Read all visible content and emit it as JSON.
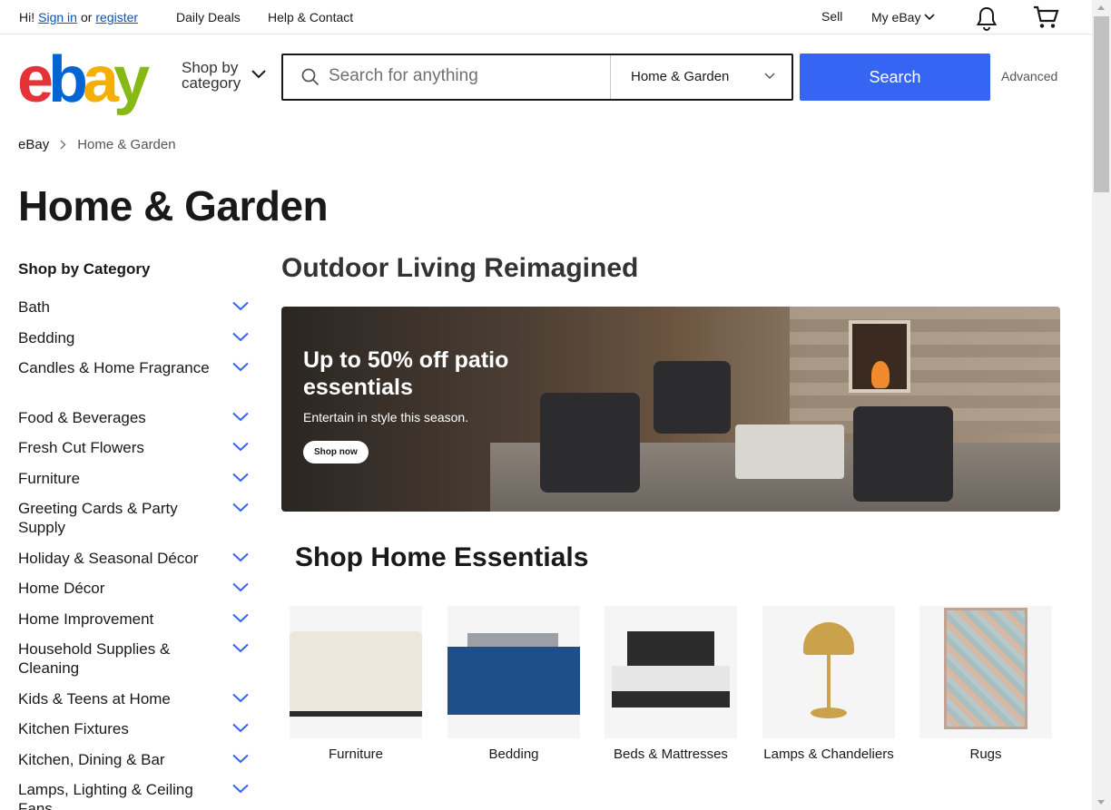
{
  "topbar": {
    "greeting": "Hi!",
    "sign_in": "Sign in",
    "or": "or",
    "register": "register",
    "daily_deals": "Daily Deals",
    "help_contact": "Help & Contact",
    "sell": "Sell",
    "my_ebay": "My eBay"
  },
  "header": {
    "logo": {
      "e": "e",
      "b": "b",
      "a": "a",
      "y": "y"
    },
    "shop_by_category": [
      "Shop by",
      "category"
    ],
    "search_placeholder": "Search for anything",
    "category_selected": "Home & Garden",
    "search_button": "Search",
    "advanced": "Advanced"
  },
  "breadcrumb": [
    "eBay",
    "Home & Garden"
  ],
  "page_title": "Home & Garden",
  "sidebar": {
    "title": "Shop by Category",
    "items": [
      "Bath",
      "Bedding",
      "Candles & Home Fragrance",
      "Food & Beverages",
      "Fresh Cut Flowers",
      "Furniture",
      "Greeting Cards & Party Supply",
      "Holiday & Seasonal Décor",
      "Home Décor",
      "Home Improvement",
      "Household Supplies & Cleaning",
      "Kids & Teens at Home",
      "Kitchen Fixtures",
      "Kitchen, Dining & Bar",
      "Lamps, Lighting & Ceiling Fans"
    ]
  },
  "promo": {
    "title": "Outdoor Living Reimagined",
    "banner_headline": "Up to 50% off patio essentials",
    "banner_sub": "Entertain in style this season.",
    "banner_button": "Shop now"
  },
  "essentials": {
    "title": "Shop Home Essentials",
    "cards": [
      "Furniture",
      "Bedding",
      "Beds & Mattresses",
      "Lamps & Chandeliers",
      "Rugs"
    ]
  },
  "colors": {
    "search_button": "#3665f3",
    "link": "#0654ba",
    "chevron": "#3665f3"
  }
}
